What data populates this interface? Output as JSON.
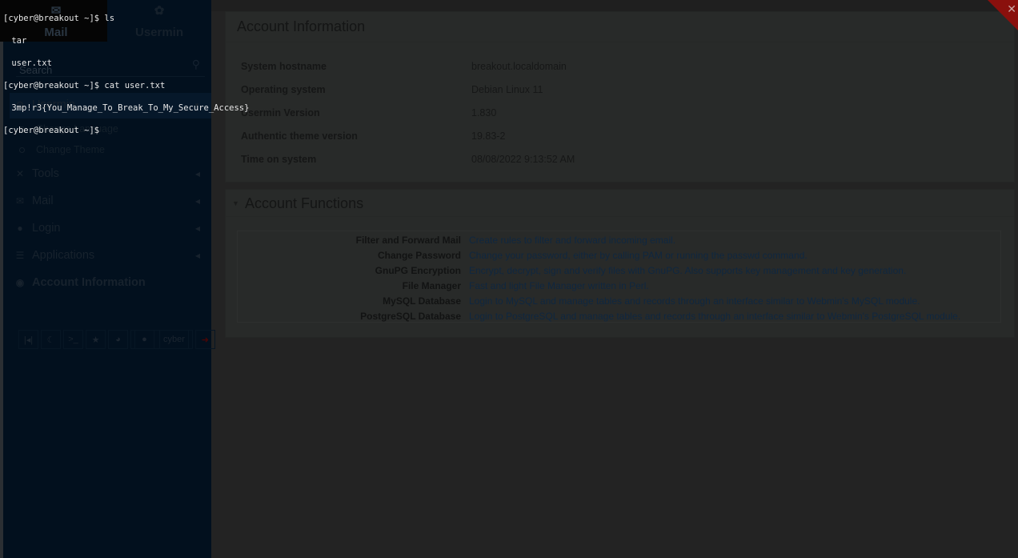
{
  "sidebar": {
    "tabs": [
      {
        "label": "Mail",
        "icon": "envelope-icon"
      },
      {
        "label": "Usermin",
        "icon": "webmin-logo-icon"
      }
    ],
    "search_placeholder": "Search",
    "section": {
      "label": "Usermin",
      "items": [
        "Change Language",
        "Change Theme"
      ]
    },
    "nav": [
      {
        "label": "Tools"
      },
      {
        "label": "Mail"
      },
      {
        "label": "Login"
      },
      {
        "label": "Applications"
      },
      {
        "label": "Account Information"
      }
    ],
    "bottom": {
      "user": "cyber"
    }
  },
  "account_info": {
    "title": "Account Information",
    "rows": [
      {
        "label": "System hostname",
        "value": "breakout.localdomain"
      },
      {
        "label": "Operating system",
        "value": "Debian Linux 11"
      },
      {
        "label": "Usermin Version",
        "value": "1.830"
      },
      {
        "label": "Authentic theme version",
        "value": "19.83-2"
      },
      {
        "label": "Time on system",
        "value": "08/08/2022 9:13:52 AM"
      }
    ]
  },
  "account_functions": {
    "title": "Account Functions",
    "rows": [
      {
        "label": "Filter and Forward Mail",
        "desc": "Create rules to filter and forward incoming email."
      },
      {
        "label": "Change Password",
        "desc": "Change your password, either by calling PAM or running the passwd command."
      },
      {
        "label": "GnuPG Encryption",
        "desc": "Encrypt, decrypt, sign and verify files with GnuPG. Also supports key management and key generation."
      },
      {
        "label": "File Manager",
        "desc": "Fast and light File Manager written in Perl."
      },
      {
        "label": "MySQL Database",
        "desc": "Login to MySQL and manage tables and records through an interface similar to Webmin's MySQL module."
      },
      {
        "label": "PostgreSQL Database",
        "desc": "Login to PostgreSQL and manage tables and records through an interface similar to Webmin's PostgreSQL module."
      }
    ]
  },
  "terminal": {
    "lines": [
      "[cyber@breakout ~]$ ls",
      " tar",
      " user.txt",
      "[cyber@breakout ~]$ cat user.txt",
      " 3mp!r3{You_Manage_To_Break_To_My_Secure_Access}",
      "[cyber@breakout ~]$"
    ]
  },
  "colors": {
    "close": "#8a100d",
    "sidebar": "#02101e",
    "link": "#0f2740"
  }
}
